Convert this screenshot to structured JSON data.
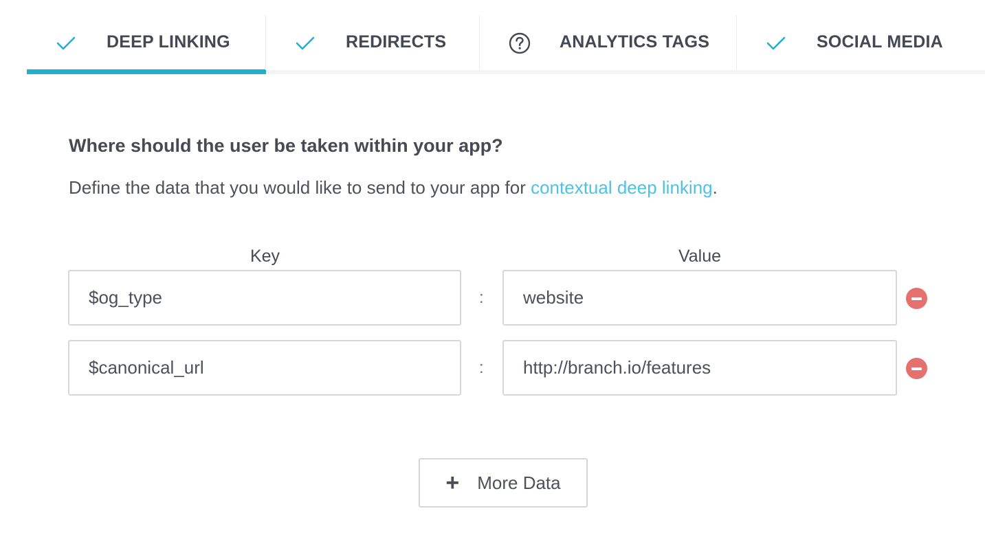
{
  "tabs": [
    {
      "label": "DEEP LINKING",
      "icon": "check-icon",
      "active": true
    },
    {
      "label": "REDIRECTS",
      "icon": "check-icon",
      "active": false
    },
    {
      "label": "ANALYTICS TAGS",
      "icon": "question-circle-icon",
      "active": false
    },
    {
      "label": "SOCIAL MEDIA",
      "icon": "check-icon",
      "active": false
    }
  ],
  "section": {
    "heading": "Where should the user be taken within your app?",
    "description": "Define the data that you would like to send to your app for ",
    "description_link": "contextual deep linking",
    "description_end": "."
  },
  "table": {
    "key_header": "Key",
    "value_header": "Value",
    "separator": ":",
    "rows": [
      {
        "key": "$og_type",
        "value": "website"
      },
      {
        "key": "$canonical_url",
        "value": "http://branch.io/features"
      }
    ]
  },
  "more_button": {
    "icon": "+",
    "label": "More Data"
  },
  "colors": {
    "accent": "#1fb0cf",
    "link": "#4cc3e3",
    "remove": "#e4716e",
    "text": "#474a55"
  }
}
